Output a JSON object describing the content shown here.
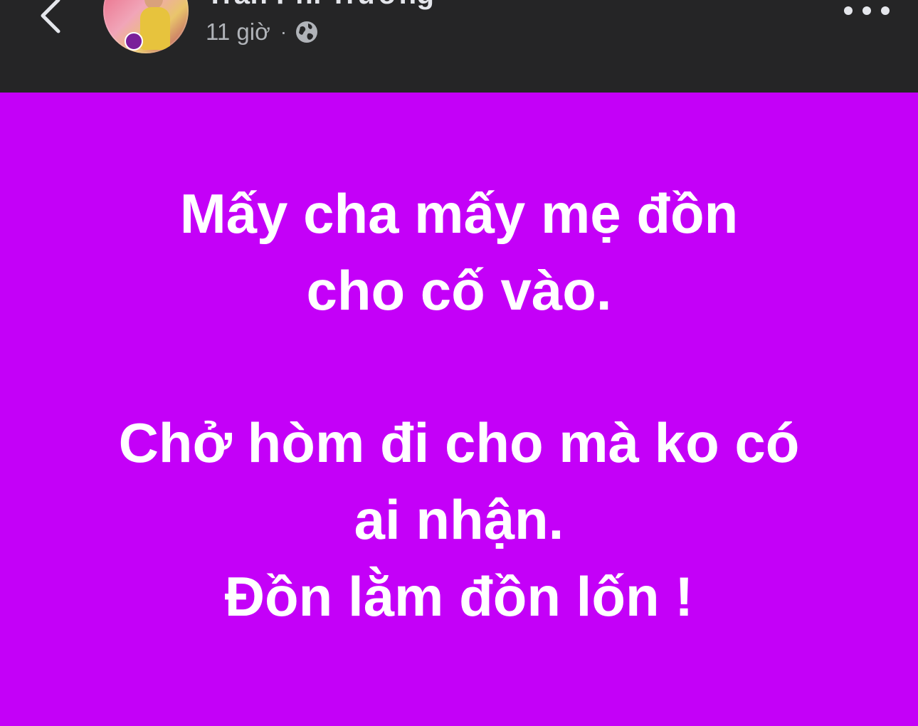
{
  "header": {
    "author_name": "Trần Phi Trường",
    "timestamp": "11 giờ",
    "separator": "·",
    "privacy_icon": "globe-icon",
    "back_icon": "chevron-left-icon",
    "more_icon": "more-horizontal-icon"
  },
  "post": {
    "background_color": "#c400f8",
    "lines": [
      "Mấy cha mấy mẹ đồn",
      "cho cố vào.",
      "Chở hòm đi cho mà ko có",
      "ai nhận.",
      "Đồn lằm đồn lốn !"
    ]
  },
  "colors": {
    "header_bg": "#252526",
    "post_text": "#ffffff",
    "meta_text": "#b0b3b8"
  }
}
